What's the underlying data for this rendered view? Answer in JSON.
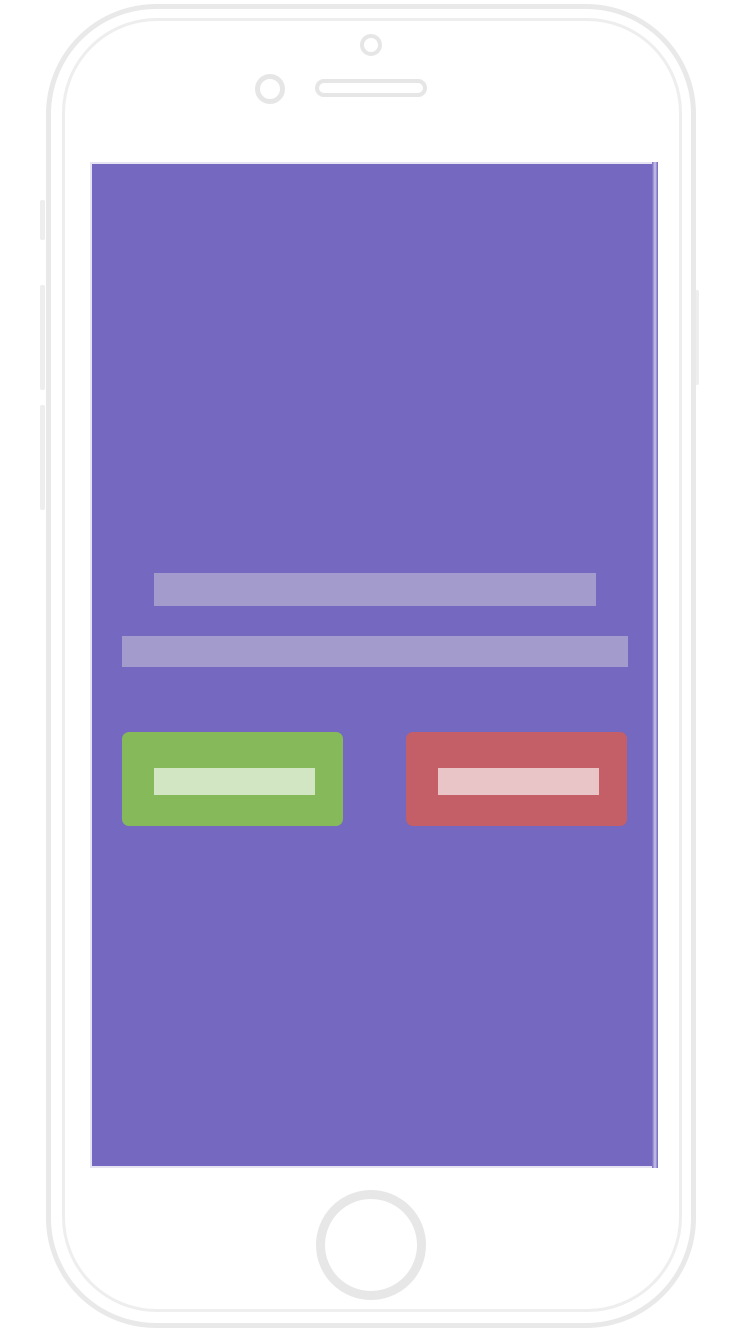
{
  "device": {
    "type": "phone-mockup",
    "frame_color": "#e9e9e9"
  },
  "screen": {
    "background_color": "#7468c0",
    "placeholder_lines": [
      {
        "text": "",
        "color": "#a29bcc"
      },
      {
        "text": "",
        "color": "#a29bcc"
      }
    ],
    "buttons": {
      "accept": {
        "label": "",
        "color": "#85b95a",
        "label_color": "#d3e6c4"
      },
      "decline": {
        "label": "",
        "color": "#c45f68",
        "label_color": "#eac5c7"
      }
    }
  },
  "icons": {
    "front_camera": "camera-icon",
    "proximity_sensor": "sensor-icon",
    "earpiece": "speaker-icon",
    "home_button": "home-button-icon"
  }
}
